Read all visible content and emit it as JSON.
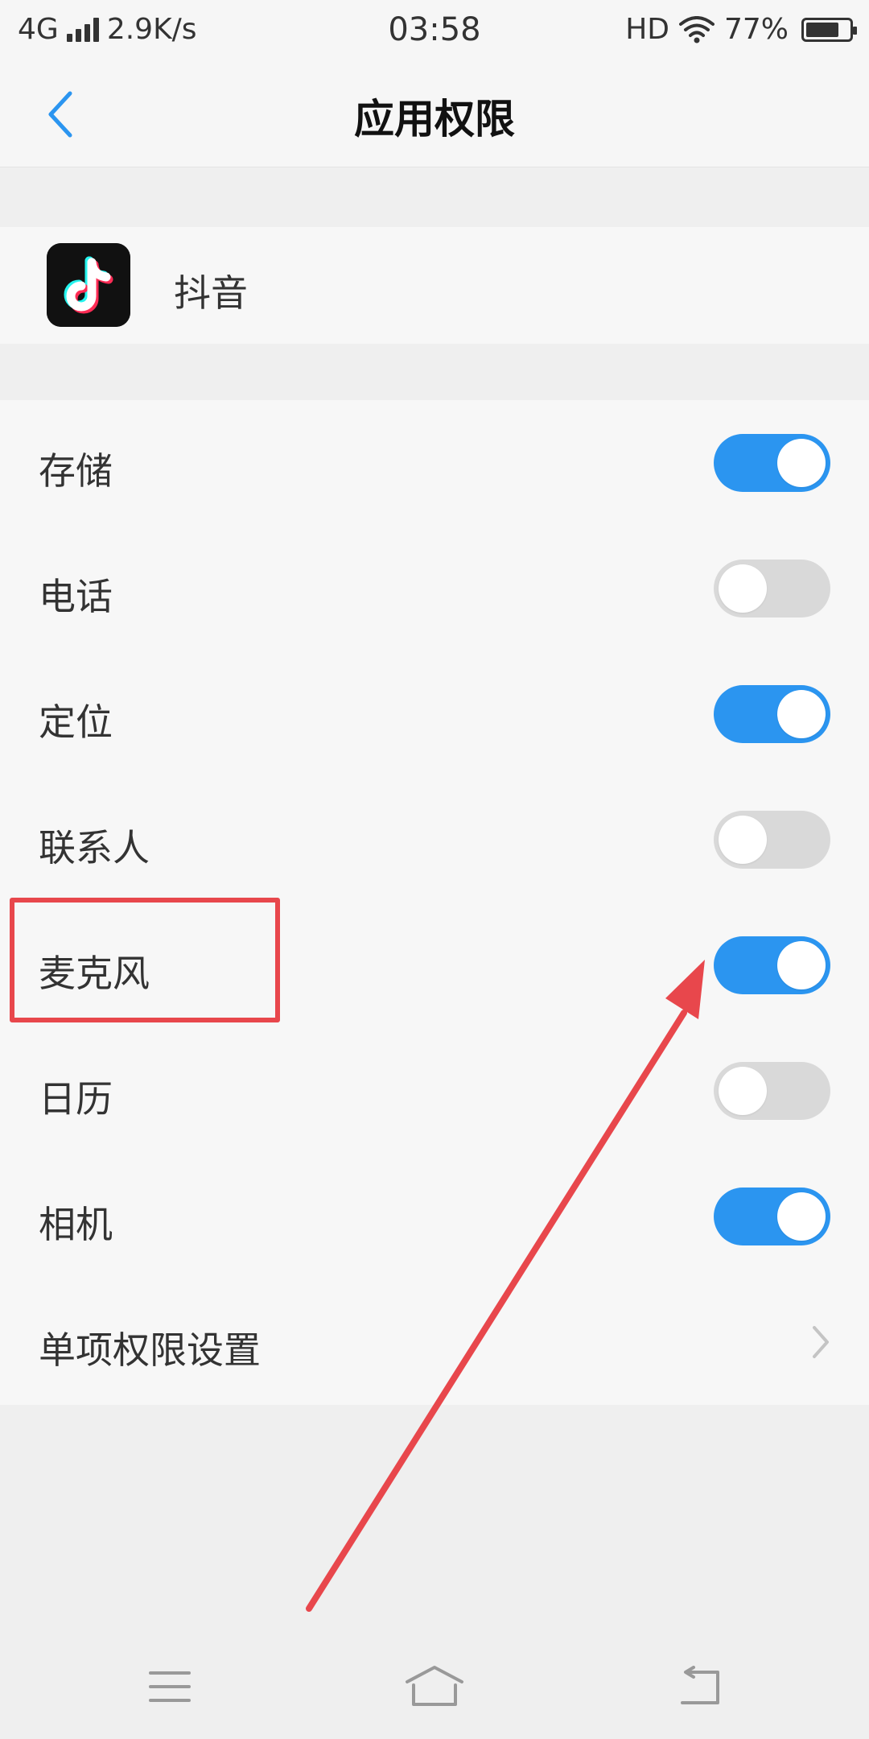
{
  "status_bar": {
    "network": "4G",
    "speed": "2.9K/s",
    "time": "03:58",
    "hd": "HD",
    "battery": "77%",
    "battery_level": 0.77
  },
  "header": {
    "title": "应用权限",
    "back_icon": "chevron-left-icon"
  },
  "app": {
    "name": "抖音",
    "icon": "tiktok-app-icon"
  },
  "permissions": [
    {
      "label": "存储",
      "enabled": true
    },
    {
      "label": "电话",
      "enabled": false
    },
    {
      "label": "定位",
      "enabled": true
    },
    {
      "label": "联系人",
      "enabled": false
    },
    {
      "label": "麦克风",
      "enabled": true
    },
    {
      "label": "日历",
      "enabled": false
    },
    {
      "label": "相机",
      "enabled": true
    }
  ],
  "single_permission": {
    "label": "单项权限设置",
    "icon": "chevron-right-icon"
  },
  "nav_bar": {
    "menu_icon": "menu-icon",
    "home_icon": "home-icon",
    "back_icon": "back-icon"
  },
  "colors": {
    "accent": "#2b95f0",
    "toggle_off": "#d9d9d9",
    "annotation": "#e8474c"
  }
}
